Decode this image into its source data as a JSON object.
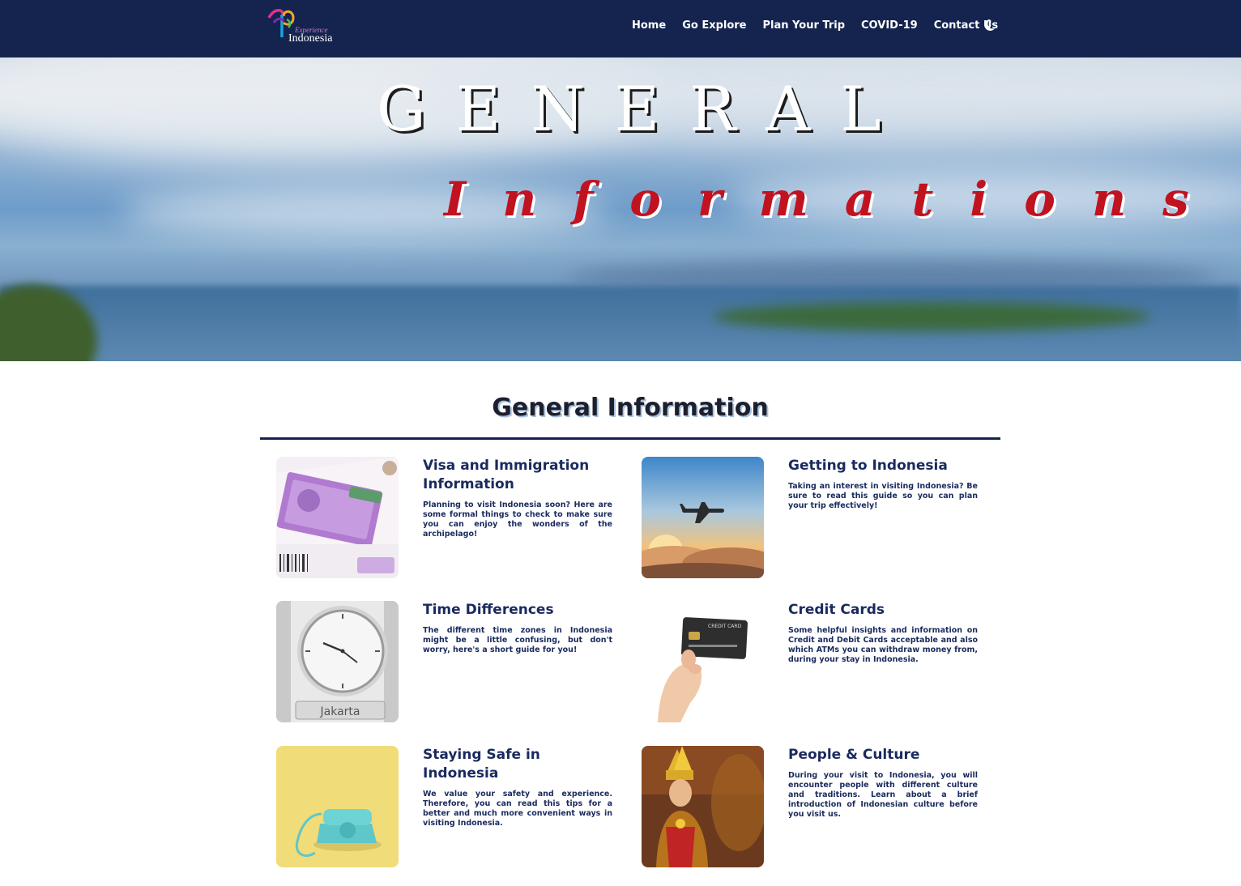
{
  "brand": {
    "logo_small": "Experience",
    "logo_name": "Indonesia"
  },
  "nav": {
    "items": [
      "Home",
      "Go Explore",
      "Plan Your Trip",
      "COVID-19",
      "Contact Us"
    ],
    "theme_toggle_icon": "moon-icon"
  },
  "hero": {
    "title": "GENERAL",
    "subtitle": "Informations"
  },
  "main": {
    "heading": "General Information",
    "cards": [
      {
        "title": "Visa and Immigration Information",
        "description": "Planning to visit Indonesia soon? Here are some formal things to check to make sure you can enjoy the wonders of the archipelago!",
        "image": "visa-stamp-image"
      },
      {
        "title": "Getting to Indonesia",
        "description": "Taking an interest in visiting Indonesia? Be sure to read this guide so you can plan your trip effectively!",
        "image": "airplane-sunset-image"
      },
      {
        "title": "Time Differences",
        "description": "The different time zones in Indonesia might be a little confusing, but don't worry, here's a short guide for you!",
        "image": "clock-image",
        "image_label": "Jakarta"
      },
      {
        "title": "Credit Cards",
        "description": "Some helpful insights and information on Credit and Debit Cards acceptable and also which ATMs you can withdraw money from, during your stay in Indonesia.",
        "image": "credit-card-image",
        "image_label": "CREDIT CARD"
      },
      {
        "title": "Staying Safe in Indonesia",
        "description": "We value your safety and experience. Therefore, you can read this tips for a better and much more convenient ways in visiting Indonesia.",
        "image": "telephone-image"
      },
      {
        "title": "People & Culture",
        "description": "During your visit to Indonesia, you will encounter people with different culture and traditions. Learn about a brief introduction of Indonesian culture before you visit us.",
        "image": "balinese-dancer-image"
      }
    ]
  },
  "colors": {
    "navbar": "#15244f",
    "accent_red": "#c1121f",
    "text_navy": "#1a2a5e"
  }
}
